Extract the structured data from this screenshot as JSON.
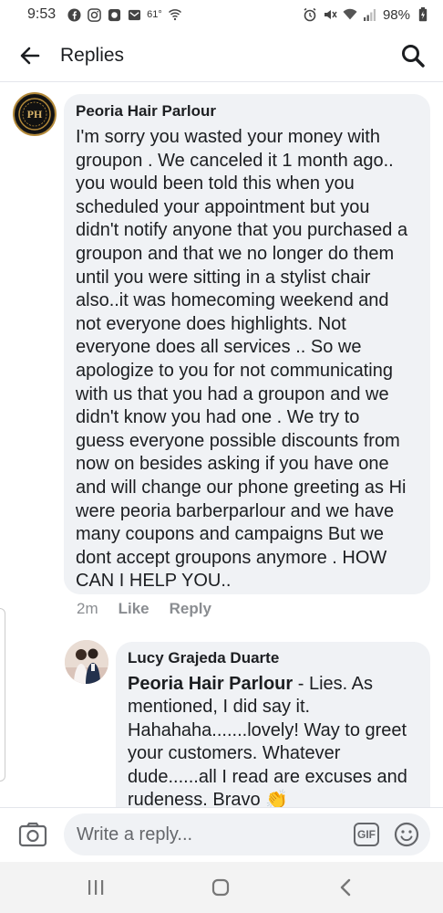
{
  "status_bar": {
    "time": "9:53",
    "temperature": "61°",
    "battery": "98%"
  },
  "header": {
    "title": "Replies"
  },
  "comments": [
    {
      "author": "Peoria Hair Parlour",
      "text": "I'm sorry you wasted your money with\ngroupon . We canceled it 1 month ago..\nyou would been  told this when you\nscheduled your appointment but you\ndidn't notify anyone that you purchased a\ngroupon and  that we no longer do them\nuntil you were sitting in a stylist chair\nalso..it was homecoming weekend and\nnot everyone does highlights.  Not\neveryone does all services .. So we\napologize to you for not communicating\nwith us that you had a groupon and we\ndidn't know you had one . We try to\nguess everyone possible discounts from\nnow on besides asking if you have one\nand will change our phone greeting as Hi\nwere peoria barberparlour and we have\nmany coupons and campaigns But we\ndont accept groupons anymore . HOW\nCAN I HELP YOU..",
      "time": "2m",
      "like_label": "Like",
      "reply_label": "Reply"
    },
    {
      "author": "Lucy Grajeda Duarte",
      "mention": "Peoria Hair Parlour",
      "text": " - Lies. As mentioned, I did say it. Hahahaha.......lovely! Way to greet your customers. Whatever dude......all I read are excuses and rudeness. Bravo ",
      "emoji": "👏"
    }
  ],
  "composer": {
    "placeholder": "Write a reply...",
    "gif_label": "GIF"
  },
  "icons": {
    "back": "back-arrow-icon",
    "search": "search-icon",
    "camera": "camera-icon",
    "emoji": "emoji-icon"
  },
  "colors": {
    "bubble": "#f0f2f5",
    "meta": "#8a8d91",
    "accent_text": "#1c1e21"
  }
}
